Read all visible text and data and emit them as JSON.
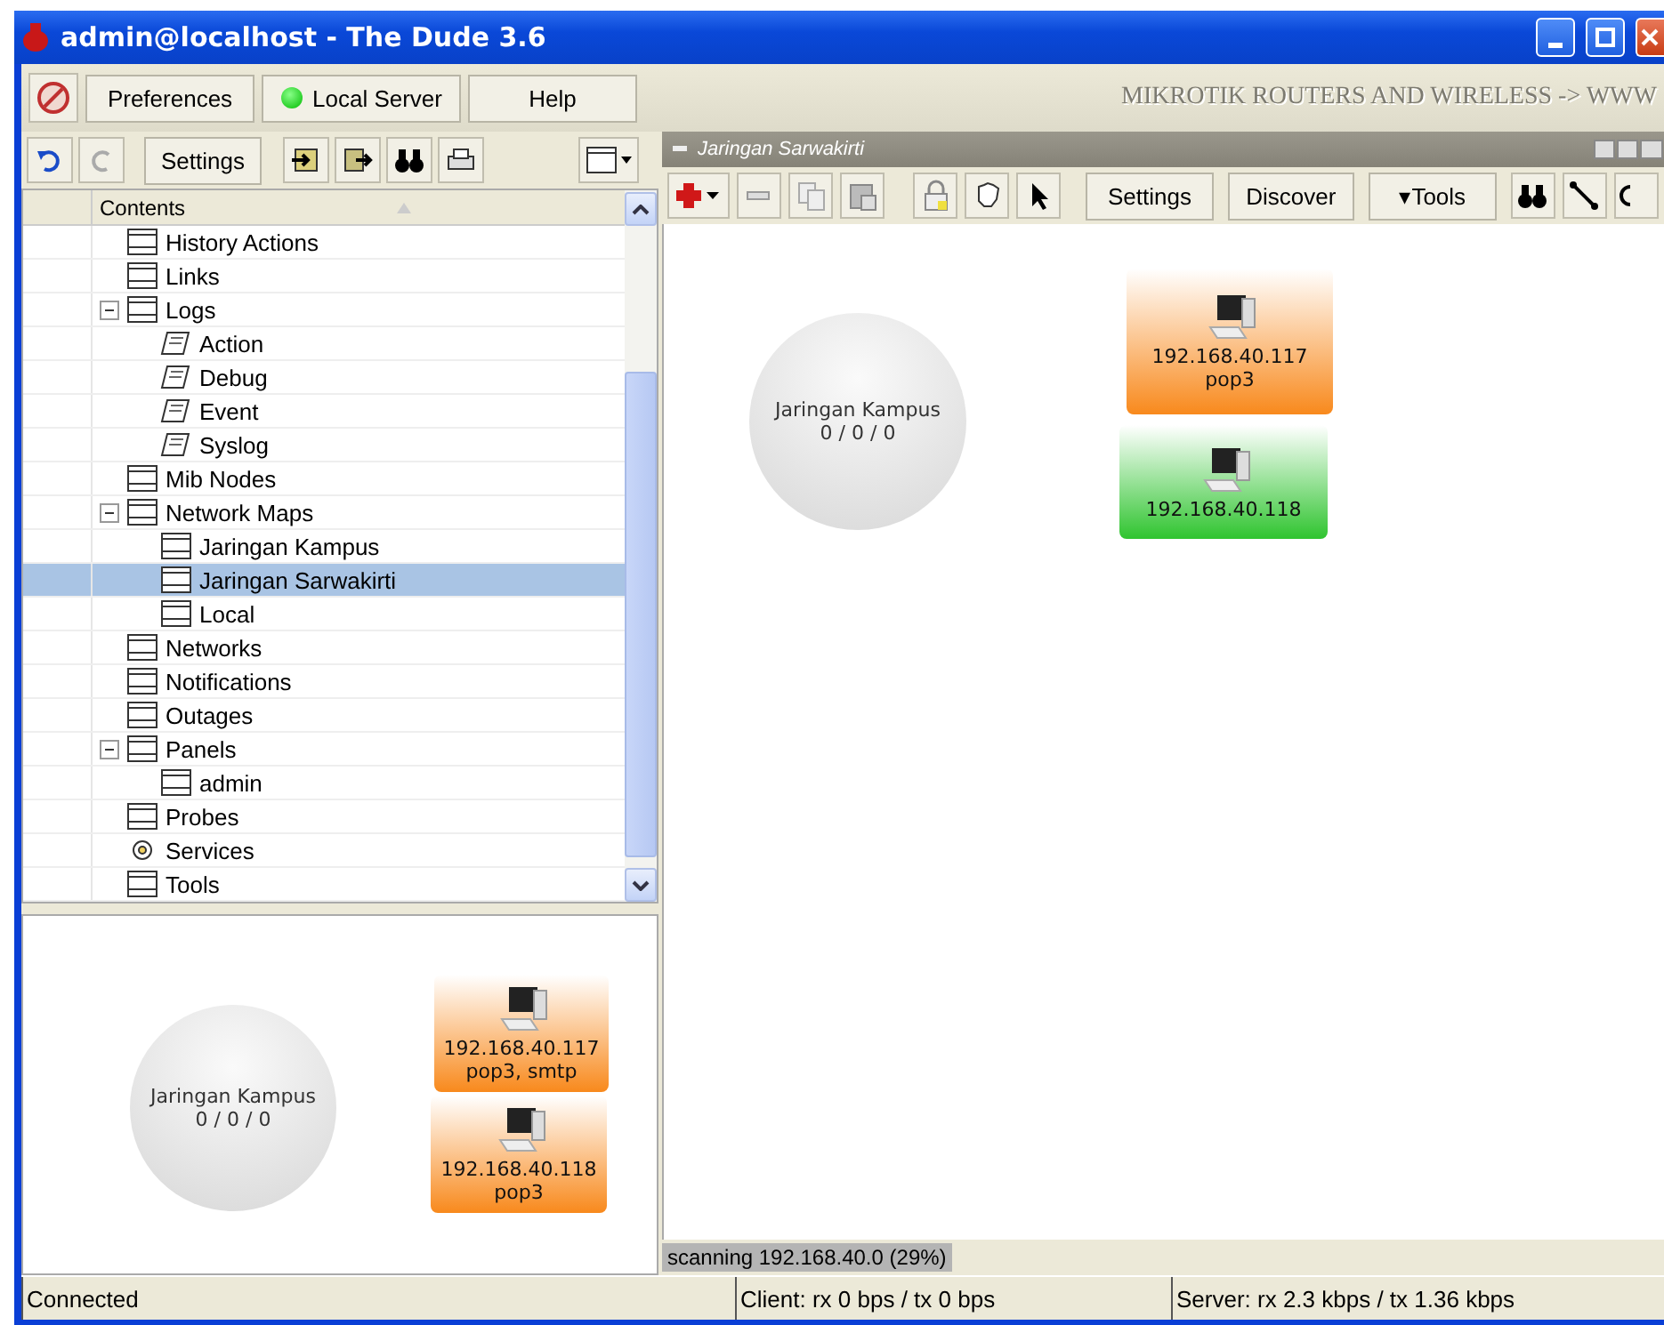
{
  "window": {
    "title": "admin@localhost - The Dude 3.6"
  },
  "menu": [
    {
      "label": "Preferences",
      "kind": "button"
    },
    {
      "label": "Local Server",
      "kind": "server"
    },
    {
      "label": "Help",
      "kind": "button"
    }
  ],
  "banner": "MIKROTIK ROUTERS AND WIRELESS -> WWW",
  "left_toolbar": {
    "settings": "Settings"
  },
  "tree": {
    "header": "Contents",
    "items": [
      {
        "label": "History Actions",
        "kind": "table"
      },
      {
        "label": "Links",
        "kind": "table"
      },
      {
        "label": "Logs",
        "kind": "table",
        "expanded": true,
        "children": [
          {
            "label": "Action",
            "kind": "log"
          },
          {
            "label": "Debug",
            "kind": "log"
          },
          {
            "label": "Event",
            "kind": "log"
          },
          {
            "label": "Syslog",
            "kind": "log"
          }
        ]
      },
      {
        "label": "Mib Nodes",
        "kind": "table"
      },
      {
        "label": "Network Maps",
        "kind": "table",
        "expanded": true,
        "children": [
          {
            "label": "Jaringan Kampus",
            "kind": "table",
            "selected": false
          },
          {
            "label": "Jaringan Sarwakirti",
            "kind": "table",
            "selected": true
          },
          {
            "label": "Local",
            "kind": "table",
            "selected": false
          }
        ]
      },
      {
        "label": "Networks",
        "kind": "table"
      },
      {
        "label": "Notifications",
        "kind": "table"
      },
      {
        "label": "Outages",
        "kind": "table"
      },
      {
        "label": "Panels",
        "kind": "table",
        "expanded": true,
        "children": [
          {
            "label": "admin",
            "kind": "table"
          }
        ]
      },
      {
        "label": "Probes",
        "kind": "table"
      },
      {
        "label": "Services",
        "kind": "service"
      },
      {
        "label": "Tools",
        "kind": "table"
      }
    ]
  },
  "mini_map": {
    "nodes": [
      {
        "kind": "network",
        "label": "Jaringan Kampus",
        "stats": "0 / 0 / 0"
      },
      {
        "kind": "device",
        "ip": "192.168.40.117",
        "services": "pop3, smtp",
        "color": "#f8891c"
      },
      {
        "kind": "device",
        "ip": "192.168.40.118",
        "services": "pop3",
        "color": "#f8891c"
      }
    ]
  },
  "map_panel": {
    "title": "Jaringan Sarwakirti",
    "toolbar": [
      "Settings",
      "Discover",
      "▾Tools"
    ],
    "nodes": [
      {
        "kind": "network",
        "label": "Jaringan Kampus",
        "stats": "0 / 0 / 0"
      },
      {
        "kind": "device",
        "ip": "192.168.40.117",
        "services": "pop3",
        "color": "#f8891c"
      },
      {
        "kind": "device",
        "ip": "192.168.40.118",
        "color": "#2fc42f"
      }
    ],
    "scan_status": "scanning 192.168.40.0 (29%)"
  },
  "status_bar": [
    "Connected",
    "Client: rx 0 bps / tx 0 bps",
    "Server: rx 2.3 kbps / tx 1.36 kbps"
  ]
}
